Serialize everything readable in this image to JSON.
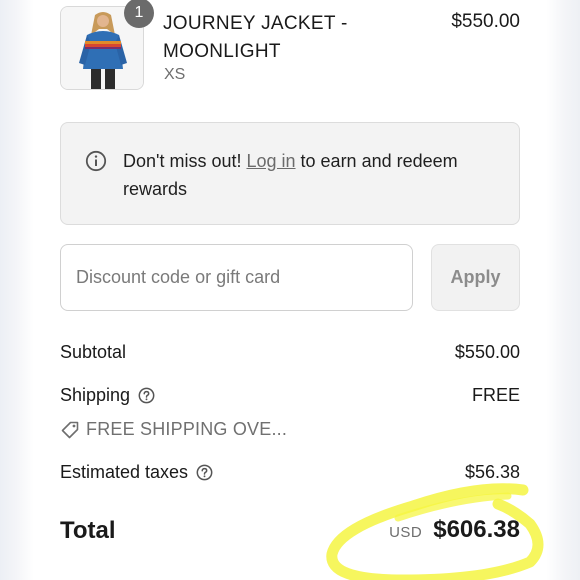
{
  "product": {
    "quantity": "1",
    "name": "JOURNEY JACKET - MOONLIGHT",
    "variant": "XS",
    "price": "$550.00"
  },
  "rewards_notice": {
    "icon": "info-icon",
    "text_before": "Don't miss out! ",
    "link_label": "Log in",
    "text_after": " to earn and redeem rewards"
  },
  "discount": {
    "placeholder": "Discount code or gift card",
    "value": "",
    "apply_label": "Apply"
  },
  "summary": {
    "subtotal_label": "Subtotal",
    "subtotal_value": "$550.00",
    "shipping_label": "Shipping",
    "shipping_value": "FREE",
    "shipping_note": "FREE SHIPPING OVE...",
    "taxes_label": "Estimated taxes",
    "taxes_value": "$56.38",
    "total_label": "Total",
    "total_currency": "USD",
    "total_value": "$606.38"
  },
  "colors": {
    "highlight": "#f5f542",
    "badge": "#6b6b6b",
    "notice_bg": "#f3f3f3"
  }
}
